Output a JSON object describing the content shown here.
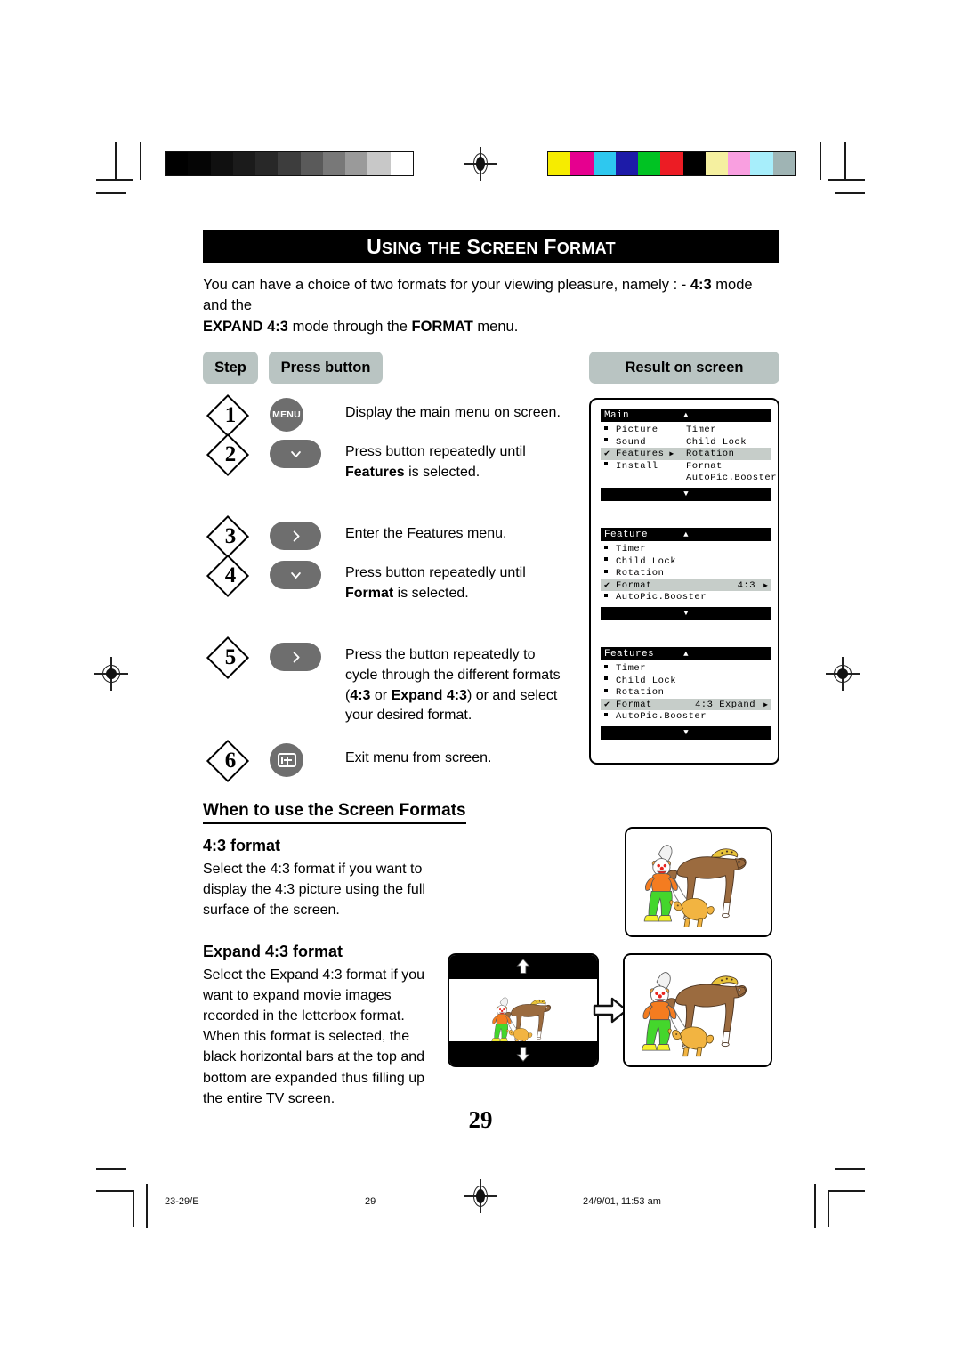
{
  "document": {
    "title": "Using the Screen Format",
    "title_first_caps": [
      "U",
      "S",
      "F"
    ],
    "page_number": "29",
    "intro_line1_a": "You can have a choice of two formats for your viewing pleasure, namely : - ",
    "intro_line1_b": "4:3",
    "intro_line1_c": " mode and the",
    "intro_line2_a": "EXPAND 4:3",
    "intro_line2_b": " mode through the ",
    "intro_line2_c": "FORMAT",
    "intro_line2_d": " menu."
  },
  "table_headers": {
    "step": "Step",
    "press_button": "Press button",
    "result": "Result on screen"
  },
  "steps": [
    {
      "number": "1",
      "button_icon": "menu-button",
      "button_label": "MENU",
      "desc_plain": "Display the main menu on screen.",
      "desc_line1": "Display the main menu on screen.",
      "desc_line2_pre": "",
      "desc_line2_bold": "",
      "desc_line2_post": ""
    },
    {
      "number": "2",
      "button_icon": "chevron-down-button",
      "button_label": "",
      "desc_line1": "Press button repeatedly until",
      "desc_line2_bold": "Features",
      "desc_line2_post": " is selected."
    },
    {
      "number": "3",
      "button_icon": "chevron-right-button",
      "button_label": "",
      "desc_line1": "Enter the Features menu.",
      "desc_line2_bold": "",
      "desc_line2_post": ""
    },
    {
      "number": "4",
      "button_icon": "chevron-down-button",
      "button_label": "",
      "desc_line1": "Press button repeatedly until",
      "desc_line2_bold": "Format",
      "desc_line2_post": " is selected."
    },
    {
      "number": "5",
      "button_icon": "chevron-right-button",
      "button_label": "",
      "desc_line1": "Press the button repeatedly to",
      "desc_line2": "cycle through the different formats",
      "desc_line3_pre": "(",
      "desc_line3_b1": "4:3",
      "desc_line3_mid": " or ",
      "desc_line3_b2": "Expand 4:3",
      "desc_line3_post": ") or and select",
      "desc_line4": "your desired format."
    },
    {
      "number": "6",
      "button_icon": "exit-button",
      "button_label": "",
      "desc_line1": "Exit menu from screen.",
      "desc_line2_bold": "",
      "desc_line2_post": ""
    }
  ],
  "osd_screens": [
    {
      "name": "main-menu",
      "title": "Main",
      "up_arrow": "▲",
      "down_arrow": "▼",
      "rows": [
        {
          "mark": "square",
          "label": "Picture",
          "col2": "Timer",
          "arrow": "",
          "highlight": false
        },
        {
          "mark": "square",
          "label": "Sound",
          "col2": "Child Lock",
          "arrow": "",
          "highlight": false
        },
        {
          "mark": "check",
          "label": "Features",
          "col2": "Rotation",
          "arrow": "▶",
          "highlight": true
        },
        {
          "mark": "square",
          "label": "Install",
          "col2": "Format",
          "arrow": "",
          "highlight": false
        },
        {
          "mark": "",
          "label": "",
          "col2": "AutoPic.Booster",
          "arrow": "",
          "highlight": false
        }
      ]
    },
    {
      "name": "feature-menu-43",
      "title": "Feature",
      "up_arrow": "▲",
      "down_arrow": "▼",
      "rows": [
        {
          "mark": "square",
          "label": "Timer",
          "value": "",
          "arrow": "",
          "highlight": false
        },
        {
          "mark": "square",
          "label": "Child Lock",
          "value": "",
          "arrow": "",
          "highlight": false
        },
        {
          "mark": "square",
          "label": "Rotation",
          "value": "",
          "arrow": "",
          "highlight": false
        },
        {
          "mark": "check",
          "label": "Format",
          "value": "4:3",
          "arrow": "▶",
          "highlight": true
        },
        {
          "mark": "square",
          "label": "AutoPic.Booster",
          "value": "",
          "arrow": "",
          "highlight": false
        }
      ]
    },
    {
      "name": "features-menu-expand",
      "title": "Features",
      "up_arrow": "▲",
      "down_arrow": "▼",
      "rows": [
        {
          "mark": "square",
          "label": "Timer",
          "value": "",
          "arrow": "",
          "highlight": false
        },
        {
          "mark": "square",
          "label": "Child Lock",
          "value": "",
          "arrow": "",
          "highlight": false
        },
        {
          "mark": "square",
          "label": "Rotation",
          "value": "",
          "arrow": "",
          "highlight": false
        },
        {
          "mark": "check",
          "label": "Format",
          "value": "4:3 Expand",
          "arrow": "▶",
          "highlight": true
        },
        {
          "mark": "square",
          "label": "AutoPic.Booster",
          "value": "",
          "arrow": "",
          "highlight": false
        }
      ]
    }
  ],
  "lower_section": {
    "heading": "When to use the Screen Formats",
    "format43": {
      "heading": "4:3 format",
      "body": "Select the 4:3 format if you want to display the 4:3 picture using the full surface of the screen."
    },
    "expand43": {
      "heading": "Expand 4:3 format",
      "body": "Select the Expand 4:3 format if you want to expand movie images recorded in the letterbox format. When this format is selected, the black horizontal bars at the top and bottom are expanded thus filling up the entire TV screen."
    },
    "illustration_alt": "clown-with-horse-and-dog"
  },
  "footer": {
    "left": "23-29/E",
    "center": "29",
    "right": "24/9/01, 11:53 am"
  },
  "calibration": {
    "grayscale": [
      "#000000",
      "#050505",
      "#101010",
      "#1b1b1b",
      "#282828",
      "#3d3d3d",
      "#5a5a5a",
      "#787878",
      "#9a9a9a",
      "#c8c8c8",
      "#ffffff"
    ],
    "colors": [
      "#f6ec00",
      "#e6008f",
      "#2ec8ef",
      "#1d1ba8",
      "#00c323",
      "#ec1c24",
      "#000000",
      "#f5f0a0",
      "#f99fe0",
      "#a7eefb",
      "#9fb4b4"
    ]
  },
  "colors": {
    "pill_bg": "#b9c4c2",
    "button_gray": "#6e6e6e",
    "osd_highlight": "#c6cdc9",
    "title_bg": "#000000"
  }
}
